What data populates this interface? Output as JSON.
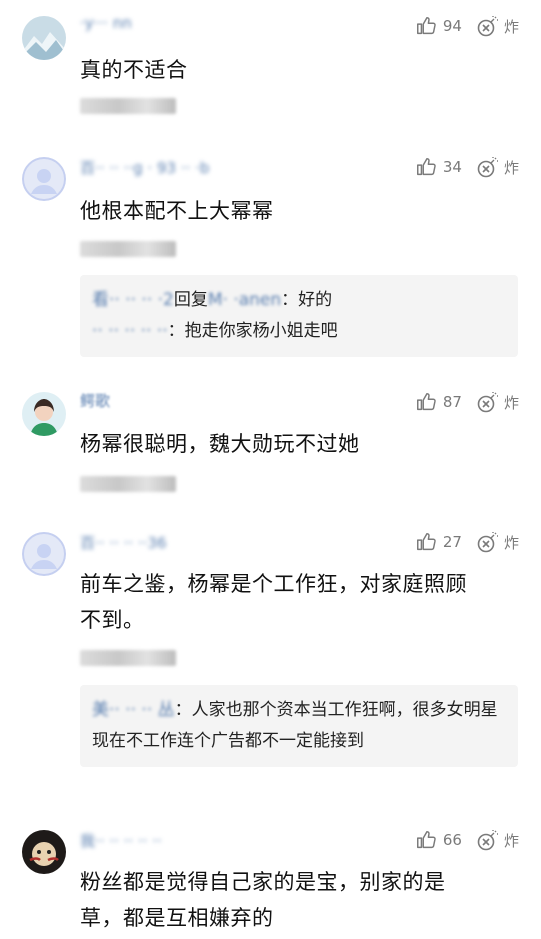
{
  "colors": {
    "username": "#5a7fb0",
    "meta": "#7a7a7a",
    "reply_bg": "#f4f4f4"
  },
  "icons": {
    "like": "thumbs-up-icon",
    "bomb": "bomb-icon"
  },
  "comments": [
    {
      "username": "·y··· nn",
      "likes": "94",
      "bomb_label": "炸",
      "text": "真的不适合",
      "avatar": "mountain-avatar"
    },
    {
      "username": "百·· ·· ··g · 93 ·· ·b",
      "likes": "34",
      "bomb_label": "炸",
      "text": "他根本配不上大幂幂",
      "avatar": "default-avatar",
      "replies": [
        {
          "name": "看·· ·· ·· ·2",
          "mid": "回复",
          "target": "M· ·anen",
          "body": "：好的"
        },
        {
          "name": "·· ·· ·· ·· ··",
          "mid": "",
          "target": "",
          "body": "：抱走你家杨小姐走吧"
        }
      ]
    },
    {
      "username": "鳄歌",
      "likes": "87",
      "bomb_label": "炸",
      "text": "杨幂很聪明，魏大勋玩不过她",
      "avatar": "photo-avatar-girl"
    },
    {
      "username": "百·· ·· ·· ··36",
      "likes": "27",
      "bomb_label": "炸",
      "text_line1": "前车之鉴，杨幂是个工作狂，对家庭照顾",
      "text_line2": "不到。",
      "avatar": "default-avatar",
      "reply_name": "美·· ·· ·· 丛",
      "reply_body": "：人家也那个资本当工作狂啊，很多女明星现在不工作连个广告都不一定能接到"
    },
    {
      "username": "我·· ·· ·· ·· ··",
      "likes": "66",
      "bomb_label": "炸",
      "text_line1": "粉丝都是觉得自己家的是宝，别家的是",
      "text_line2": "草，都是互相嫌弃的",
      "avatar": "photo-avatar-dark"
    }
  ]
}
